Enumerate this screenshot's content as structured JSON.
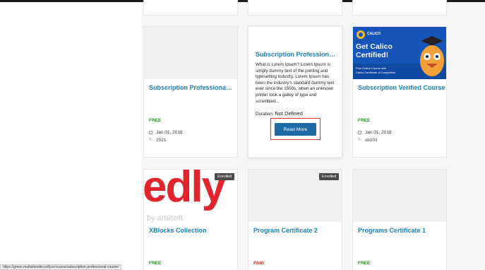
{
  "cards": [
    {
      "title": "Subscription Professional C...",
      "price": "FREE",
      "date": "Jan 01, 2018",
      "code": "2021"
    },
    {
      "title": "Subscription Professional...",
      "description": "What is Lorem Ipsum? Lorem Ipsum is simply dummy text of the printing and typesetting industry. Lorem Ipsum has been the industry's standard dummy text ever since the 1500s, when an unknown printer took a galley of type and scrambled...",
      "duration_label": "Duration:",
      "duration_value": "Not Defined",
      "button": "Read More"
    },
    {
      "title": "Subscription Verified Course",
      "price": "FREE",
      "date": "Jan 01, 2018",
      "code": "sb101"
    },
    {
      "title": "XBlocks Collection",
      "price": "FREE",
      "badge": "Enrolled"
    },
    {
      "title": "Program Certificate 2",
      "price": "PAID",
      "badge": "Enrolled"
    },
    {
      "title": "Programs Certificate 1",
      "price": "FREE"
    }
  ],
  "calico_ad": {
    "logo_top": "CALICO",
    "headline1": "Get Calico",
    "headline2": "Certified!",
    "sub1": "Free Online Course with",
    "sub2": "Calico Certificate of Completion"
  },
  "edly_logo": {
    "main": "edly",
    "sub": "by arbisoft"
  },
  "status_url": "https://green.multisitesdev.edly.io/course/subscription-professional-course/",
  "colors": {
    "link": "#1b7fb5",
    "free": "#2f8a2f",
    "paid": "#c0392b",
    "button": "#1d6aa5",
    "highlight": "#d9342b",
    "edly_red": "#e1252c"
  }
}
